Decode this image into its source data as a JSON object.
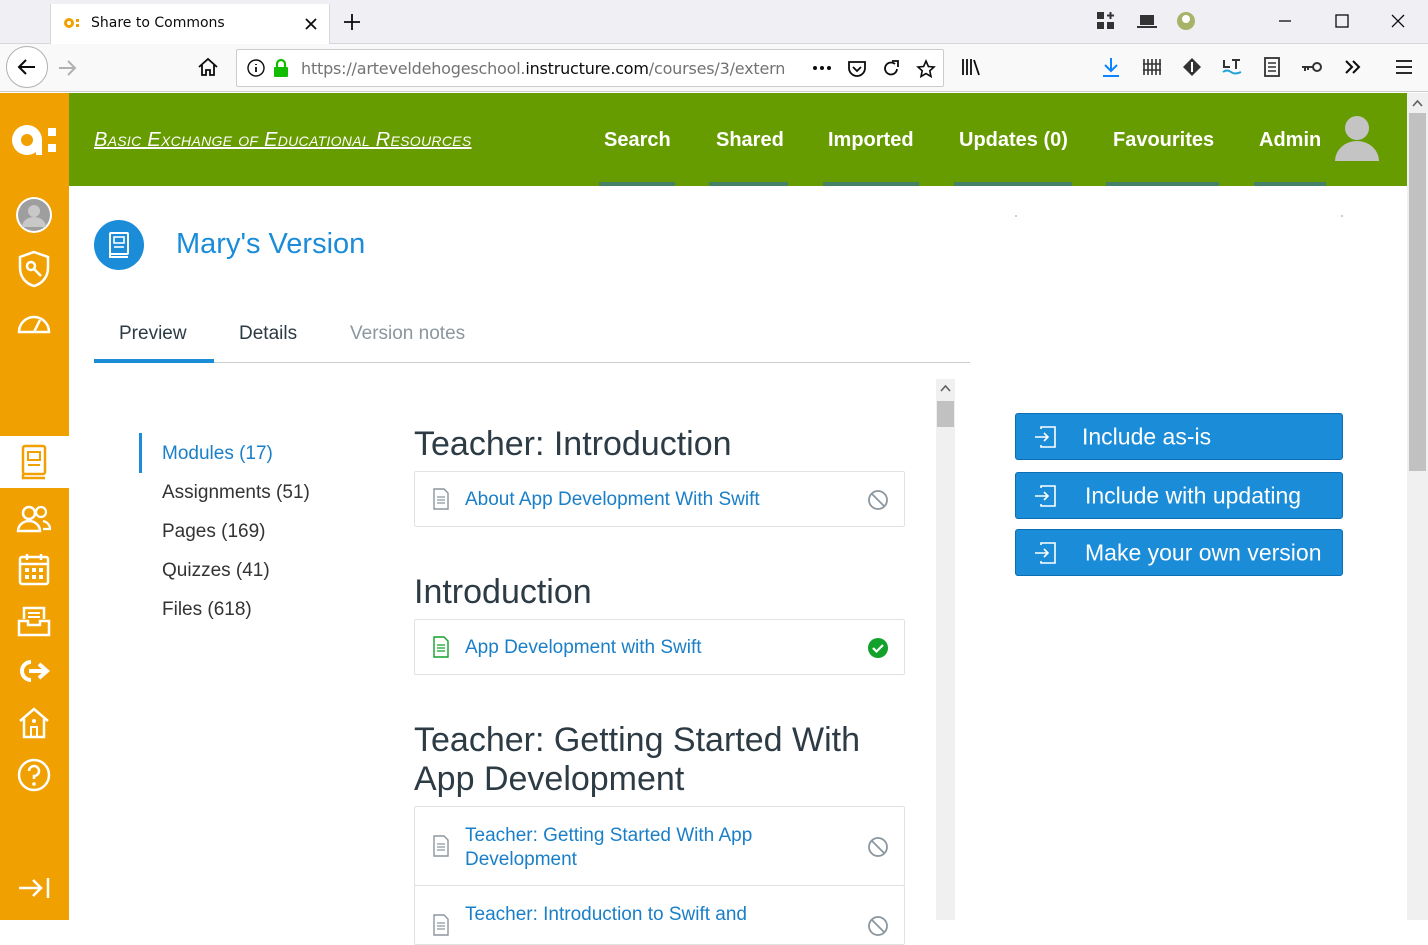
{
  "browser": {
    "tab_title": "Share to Commons",
    "url_prefix": "https://arteveldehogeschool.",
    "url_domain": "instructure.com",
    "url_suffix": "/courses/3/extern"
  },
  "header": {
    "site_title": "Basic Exchange of Educational Resources",
    "nav": [
      "Search",
      "Shared",
      "Imported",
      "Updates (0)",
      "Favourites",
      "Admin"
    ]
  },
  "page": {
    "title": "Mary's Version",
    "tabs": [
      "Preview",
      "Details",
      "Version notes"
    ]
  },
  "left_nav": [
    "Modules (17)",
    "Assignments (51)",
    "Pages (169)",
    "Quizzes (41)",
    "Files (618)"
  ],
  "sections": [
    {
      "heading": "Teacher: Introduction",
      "items": [
        {
          "title": "About App Development With Swift",
          "status": "unpublished"
        }
      ]
    },
    {
      "heading": "Introduction",
      "items": [
        {
          "title": "App Development with Swift",
          "status": "published"
        }
      ]
    },
    {
      "heading": "Teacher: Getting Started With App Development",
      "items": [
        {
          "title": "Teacher: Getting Started With App Development",
          "status": "unpublished"
        },
        {
          "title": "Teacher: Introduction to Swift and",
          "status": "unpublished"
        }
      ]
    }
  ],
  "actions": [
    "Include as-is",
    "Include with updating",
    "Make your own version"
  ],
  "colors": {
    "sidebar": "#f0a000",
    "header": "#669c00",
    "accent": "#1a8cd8"
  }
}
